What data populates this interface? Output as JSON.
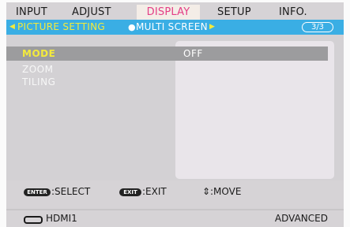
{
  "tabs": [
    {
      "label": "INPUT",
      "active": false
    },
    {
      "label": "ADJUST",
      "active": false
    },
    {
      "label": "DISPLAY",
      "active": true
    },
    {
      "label": "SETUP",
      "active": false
    },
    {
      "label": "INFO.",
      "active": false
    }
  ],
  "subtabs": {
    "left_arrow": "◀",
    "active": "PICTURE SETTING",
    "separator": "●",
    "inactive": "MULTI SCREEN",
    "right_arrow": "▶",
    "page": "3/3"
  },
  "menu": {
    "items": [
      {
        "label": "MODE",
        "selected": true
      },
      {
        "label": "ZOOM",
        "selected": false
      },
      {
        "label": "TILING",
        "selected": false
      }
    ],
    "selected_value": "OFF"
  },
  "help": {
    "enter_key": "ENTER",
    "enter_text": ":SELECT",
    "exit_key": "EXIT",
    "exit_text": ":EXIT",
    "move_icon": "⇕",
    "move_text": ":MOVE"
  },
  "status": {
    "input_icon": "hdmi-port-icon",
    "input": "HDMI1",
    "mode": "ADVANCED"
  },
  "colors": {
    "active_tab_text": "#e43e86",
    "subbar_bg": "#3aaee4",
    "highlight_text": "#f3ea3c",
    "selected_row": "#9c9c9e"
  }
}
